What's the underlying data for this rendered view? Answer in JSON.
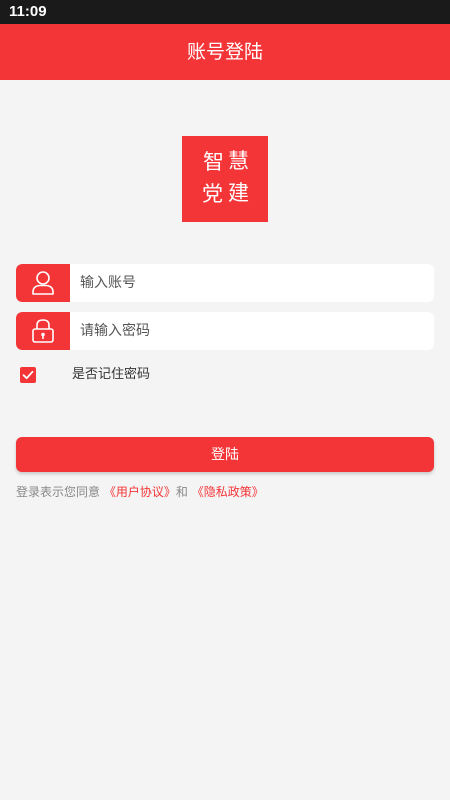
{
  "status_bar": {
    "time": "11:09"
  },
  "header": {
    "title": "账号登陆"
  },
  "logo": {
    "chars": [
      "智",
      "慧",
      "党",
      "建"
    ]
  },
  "form": {
    "account": {
      "placeholder": "输入账号",
      "value": ""
    },
    "password": {
      "placeholder": "请输入密码",
      "value": ""
    },
    "remember": {
      "label": "是否记住密码",
      "checked": true
    },
    "login_label": "登陆"
  },
  "agreement": {
    "prefix": "登录表示您同意",
    "user_agreement": "《用户协议》",
    "conjunction": "和",
    "privacy_policy": "《隐私政策》"
  },
  "colors": {
    "accent": "#f43538",
    "background": "#f4f4f4",
    "status_bar": "#1a1a1a"
  },
  "icons": {
    "account": "user-icon",
    "password": "lock-icon",
    "remember": "checkmark-icon"
  }
}
